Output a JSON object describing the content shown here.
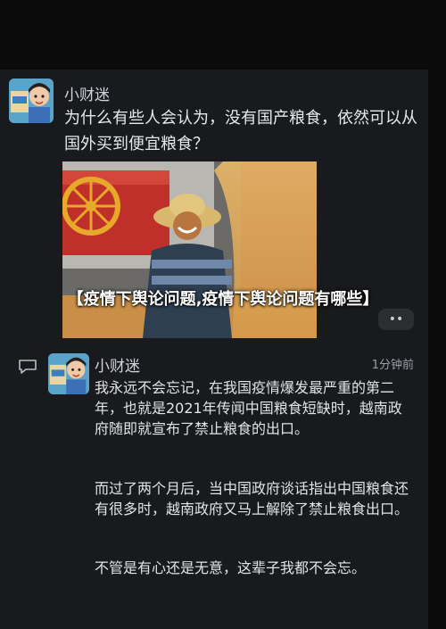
{
  "post": {
    "author": "小财迷",
    "question": "为什么有些人会认为，没有国产粮食，依然可以从国外买到便宜粮食？"
  },
  "overlay": {
    "title": "【疫情下舆论问题,疫情下舆论问题有哪些】",
    "more_label": "••"
  },
  "comment": {
    "author": "小财迷",
    "time": "1分钟前",
    "paragraphs": [
      "我永远不会忘记，在我国疫情爆发最严重的第二年，也就是2021年传闻中国粮食短缺时，越南政府随即就宣布了禁止粮食的出口。",
      "而过了两个月后，当中国政府谈话指出中国粮食还有很多时，越南政府又马上解除了禁止粮食出口。",
      "不管是有心还是无意，这辈子我都不会忘。"
    ]
  },
  "colors": {
    "background": "#0b0b0c",
    "panel": "#191a1d",
    "text": "#e6e8eb",
    "muted": "#9aa0a6"
  }
}
